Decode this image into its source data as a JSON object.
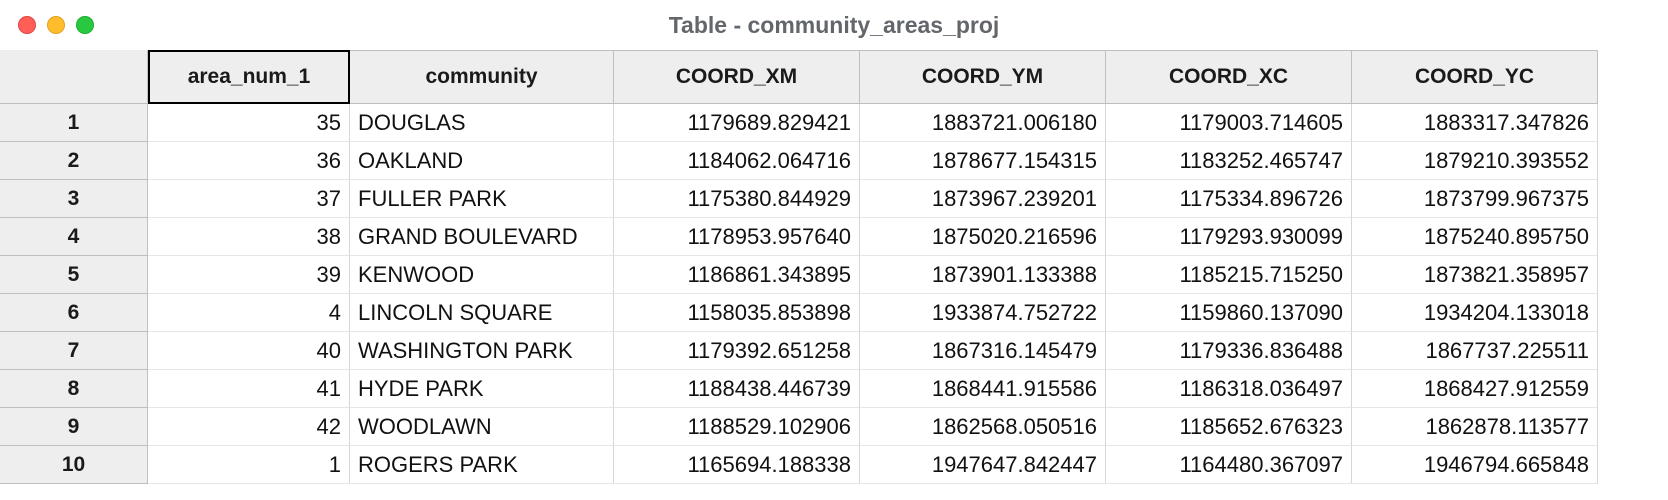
{
  "window": {
    "title": "Table - community_areas_proj"
  },
  "columns": [
    {
      "key": "area_num_1",
      "label": "area_num_1",
      "align": "num",
      "wclass": "w-area",
      "active": true
    },
    {
      "key": "community",
      "label": "community",
      "align": "text",
      "wclass": "w-comm",
      "active": false
    },
    {
      "key": "COORD_XM",
      "label": "COORD_XM",
      "align": "num",
      "wclass": "w-coord",
      "active": false
    },
    {
      "key": "COORD_YM",
      "label": "COORD_YM",
      "align": "num",
      "wclass": "w-coord",
      "active": false
    },
    {
      "key": "COORD_XC",
      "label": "COORD_XC",
      "align": "num",
      "wclass": "w-coord",
      "active": false
    },
    {
      "key": "COORD_YC",
      "label": "COORD_YC",
      "align": "num",
      "wclass": "w-last",
      "active": false
    }
  ],
  "rows": [
    {
      "n": "1",
      "area_num_1": "35",
      "community": "DOUGLAS",
      "COORD_XM": "1179689.829421",
      "COORD_YM": "1883721.006180",
      "COORD_XC": "1179003.714605",
      "COORD_YC": "1883317.347826"
    },
    {
      "n": "2",
      "area_num_1": "36",
      "community": "OAKLAND",
      "COORD_XM": "1184062.064716",
      "COORD_YM": "1878677.154315",
      "COORD_XC": "1183252.465747",
      "COORD_YC": "1879210.393552"
    },
    {
      "n": "3",
      "area_num_1": "37",
      "community": "FULLER PARK",
      "COORD_XM": "1175380.844929",
      "COORD_YM": "1873967.239201",
      "COORD_XC": "1175334.896726",
      "COORD_YC": "1873799.967375"
    },
    {
      "n": "4",
      "area_num_1": "38",
      "community": "GRAND BOULEVARD",
      "COORD_XM": "1178953.957640",
      "COORD_YM": "1875020.216596",
      "COORD_XC": "1179293.930099",
      "COORD_YC": "1875240.895750"
    },
    {
      "n": "5",
      "area_num_1": "39",
      "community": "KENWOOD",
      "COORD_XM": "1186861.343895",
      "COORD_YM": "1873901.133388",
      "COORD_XC": "1185215.715250",
      "COORD_YC": "1873821.358957"
    },
    {
      "n": "6",
      "area_num_1": "4",
      "community": "LINCOLN SQUARE",
      "COORD_XM": "1158035.853898",
      "COORD_YM": "1933874.752722",
      "COORD_XC": "1159860.137090",
      "COORD_YC": "1934204.133018"
    },
    {
      "n": "7",
      "area_num_1": "40",
      "community": "WASHINGTON PARK",
      "COORD_XM": "1179392.651258",
      "COORD_YM": "1867316.145479",
      "COORD_XC": "1179336.836488",
      "COORD_YC": "1867737.225511"
    },
    {
      "n": "8",
      "area_num_1": "41",
      "community": "HYDE PARK",
      "COORD_XM": "1188438.446739",
      "COORD_YM": "1868441.915586",
      "COORD_XC": "1186318.036497",
      "COORD_YC": "1868427.912559"
    },
    {
      "n": "9",
      "area_num_1": "42",
      "community": "WOODLAWN",
      "COORD_XM": "1188529.102906",
      "COORD_YM": "1862568.050516",
      "COORD_XC": "1185652.676323",
      "COORD_YC": "1862878.113577"
    },
    {
      "n": "10",
      "area_num_1": "1",
      "community": "ROGERS PARK",
      "COORD_XM": "1165694.188338",
      "COORD_YM": "1947647.842447",
      "COORD_XC": "1164480.367097",
      "COORD_YC": "1946794.665848"
    }
  ]
}
